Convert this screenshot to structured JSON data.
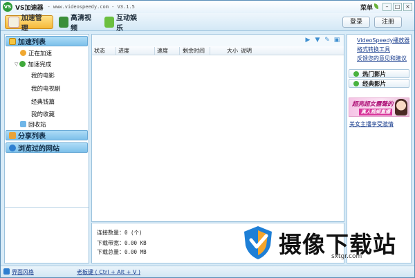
{
  "window": {
    "title": "VS加速器",
    "subtitle": "- www.videospeedy.com - V3.1.5",
    "menu_label": "菜单",
    "controls": {
      "minimize": "–",
      "maximize": "□",
      "close": "×"
    }
  },
  "toolbar": {
    "tabs": [
      {
        "label": "加速管理",
        "icon": "accelerate-icon",
        "active": true
      },
      {
        "label": "高清视频",
        "icon": "hd-video-icon",
        "active": false
      },
      {
        "label": "互动娱乐",
        "icon": "entertainment-icon",
        "active": false
      }
    ],
    "login_label": "登录",
    "register_label": "注册"
  },
  "sidebar": {
    "accel_list": "加速列表",
    "downloading": "正在加速",
    "done": "加速完成",
    "done_children": [
      "我的电影",
      "我的电视剧",
      "经典钱篇",
      "我的收藏"
    ],
    "recycle": "回收站",
    "share_list": "分享列表",
    "browsed_sites": "浏览过的网站"
  },
  "list": {
    "toolbar_icons": [
      "play-icon",
      "download-icon",
      "edit-icon",
      "delete-icon"
    ],
    "toolbar_glyphs": [
      "▶",
      "▼",
      "✎",
      "▣"
    ],
    "columns": [
      "状态",
      "进度",
      "速度",
      "剩余时间",
      "大小",
      "说明"
    ]
  },
  "stats": {
    "connections_label": "连接数量：",
    "connections_value": "0 (个)",
    "bandwidth_label": "下载带宽：",
    "bandwidth_value": "0.00 KB",
    "total_label": "下载总量：",
    "total_value": "0.00 MB"
  },
  "right_panel": {
    "links": [
      "VideoSpeedy播放器",
      "格式转换工具",
      "反馈您的意见和建议"
    ],
    "hot_movies": "热门影片",
    "classic_movies": "经典影片",
    "banner_line1": "超亮超女露聲的",
    "banner_line2": "真人视频直播",
    "beauty_link": "美女主播享受激情"
  },
  "statusbar": {
    "skin_label": "界面风格",
    "hotkey_label": "老板键 ( Ctrl + Alt + V )"
  },
  "watermark": {
    "text": "摄像下载站",
    "url": "sxtgr.com"
  },
  "colors": {
    "accent": "#f5b93a",
    "panel_bg": "#d9ecf8",
    "link": "#1b3f8f",
    "header_blue": "#7dc0ea"
  }
}
